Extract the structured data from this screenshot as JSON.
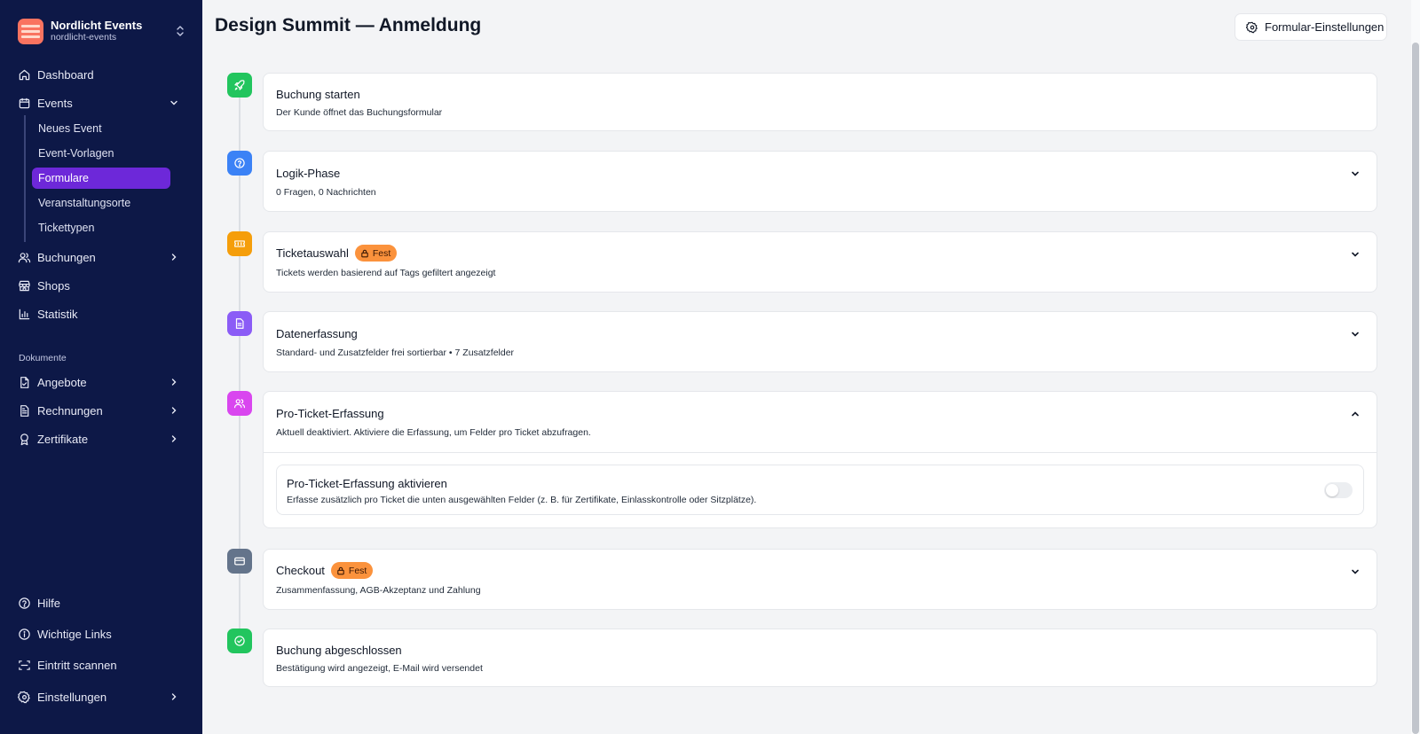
{
  "org": {
    "name": "Nordlicht Events",
    "slug": "nordlicht-events"
  },
  "nav": {
    "dashboard": "Dashboard",
    "events": "Events",
    "events_sub": [
      "Neues Event",
      "Event-Vorlagen",
      "Formulare",
      "Veranstaltungsorte",
      "Tickettypen"
    ],
    "active_sub": "Formulare",
    "buchungen": "Buchungen",
    "shops": "Shops",
    "statistik": "Statistik",
    "section_documents": "Dokumente",
    "angebote": "Angebote",
    "rechnungen": "Rechnungen",
    "zertifikate": "Zertifikate",
    "hilfe": "Hilfe",
    "links": "Wichtige Links",
    "scan": "Eintritt scannen",
    "settings": "Einstellungen"
  },
  "page": {
    "title": "Design Summit — Anmeldung",
    "settings_button": "Formular-Einstellungen"
  },
  "steps": [
    {
      "title": "Buchung starten",
      "desc": "Der Kunde öffnet das Buchungsformular",
      "icon": "rocket-icon",
      "color": "#22c55e"
    },
    {
      "title": "Logik-Phase",
      "desc": "0 Fragen, 0 Nachrichten",
      "icon": "question-circle-icon",
      "color": "#3b82f6"
    },
    {
      "title": "Ticketauswahl",
      "badge": "Fest",
      "desc": "Tickets werden basierend auf Tags gefiltert angezeigt",
      "icon": "ticket-icon",
      "color": "#f59e0b"
    },
    {
      "title": "Datenerfassung",
      "desc": "Standard- und Zusatzfelder frei sortierbar • 7 Zusatzfelder",
      "icon": "document-icon",
      "color": "#8b5cf6"
    },
    {
      "title": "Pro-Ticket-Erfassung",
      "desc": "Aktuell deaktiviert. Aktiviere die Erfassung, um Felder pro Ticket abzufragen.",
      "icon": "users-icon",
      "color": "#d946ef",
      "toggle": {
        "title": "Pro-Ticket-Erfassung aktivieren",
        "desc": "Erfasse zusätzlich pro Ticket die unten ausgewählten Felder (z. B. für Zertifikate, Einlasskontrolle oder Sitzplätze).",
        "enabled": false
      }
    },
    {
      "title": "Checkout",
      "badge": "Fest",
      "desc": "Zusammenfassung, AGB-Akzeptanz und Zahlung",
      "icon": "credit-card-icon",
      "color": "#64748b"
    },
    {
      "title": "Buchung abgeschlossen",
      "desc": "Bestätigung wird angezeigt, E-Mail wird versendet",
      "icon": "check-circle-icon",
      "color": "#22c55e"
    }
  ]
}
